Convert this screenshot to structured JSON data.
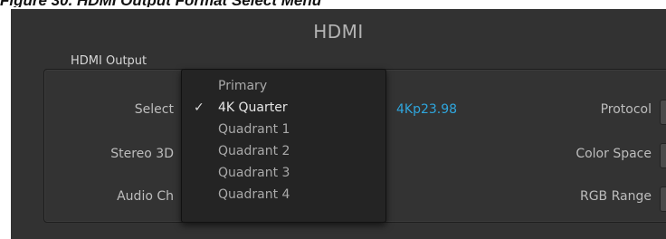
{
  "figure": {
    "caption": "Figure 30. HDMI Output Format Select Menu"
  },
  "panel": {
    "title": "HDMI",
    "section_label": "HDMI Output",
    "labels": {
      "select": "Select",
      "stereo": "Stereo 3D",
      "audio": "Audio Ch",
      "protocol": "Protocol",
      "color_space": "Color Space",
      "rgb_range": "RGB Range"
    },
    "format_value": "4Kp23.98",
    "accent_color": "#2fa6dd"
  },
  "dropdown": {
    "selected": "4K Quarter",
    "check_glyph": "✓",
    "items": [
      {
        "label": "Primary"
      },
      {
        "label": "4K Quarter"
      },
      {
        "label": "Quadrant 1"
      },
      {
        "label": "Quadrant 2"
      },
      {
        "label": "Quadrant 3"
      },
      {
        "label": "Quadrant 4"
      }
    ]
  }
}
